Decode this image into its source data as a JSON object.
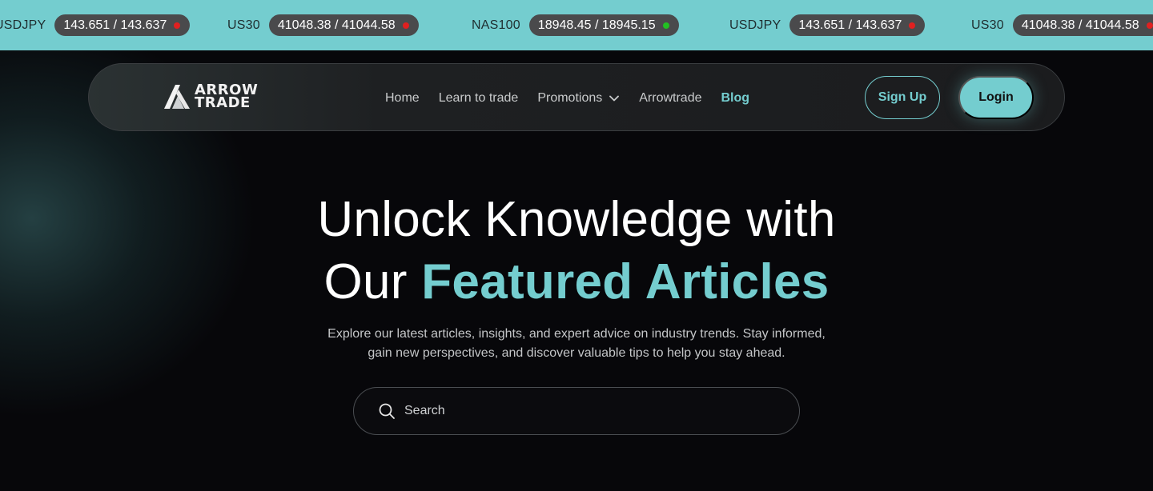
{
  "ticker": {
    "items": [
      {
        "symbol": "USDJPY",
        "quote": "143.651 / 143.637",
        "status": "down",
        "status_color": "#e02020"
      },
      {
        "symbol": "US30",
        "quote": "41048.38 / 41044.58",
        "status": "down",
        "status_color": "#e02020"
      },
      {
        "symbol": "NAS100",
        "quote": "18948.45 / 18945.15",
        "status": "up",
        "status_color": "#22c022"
      },
      {
        "symbol": "USDJPY",
        "quote": "143.651 / 143.637",
        "status": "down",
        "status_color": "#e02020"
      },
      {
        "symbol": "US30",
        "quote": "41048.38 / 41044.58",
        "status": "down",
        "status_color": "#e02020"
      }
    ]
  },
  "brand": {
    "line1": "ARROW",
    "line2": "TRADE",
    "accent_color": "#74cdcf"
  },
  "nav": {
    "links": [
      "Home",
      "Learn to trade",
      "Promotions",
      "Arrowtrade"
    ],
    "active": "Blog",
    "signup_label": "Sign Up",
    "login_label": "Login"
  },
  "hero": {
    "title_line1": "Unlock Knowledge with",
    "title_line2_plain": "Our",
    "title_line2_accent": "Featured Articles",
    "subtitle_line1": "Explore our latest articles, insights, and expert advice on industry trends. Stay informed,",
    "subtitle_line2": "gain new perspectives, and discover valuable tips to help you stay ahead."
  },
  "search": {
    "placeholder": "Search",
    "value": ""
  }
}
